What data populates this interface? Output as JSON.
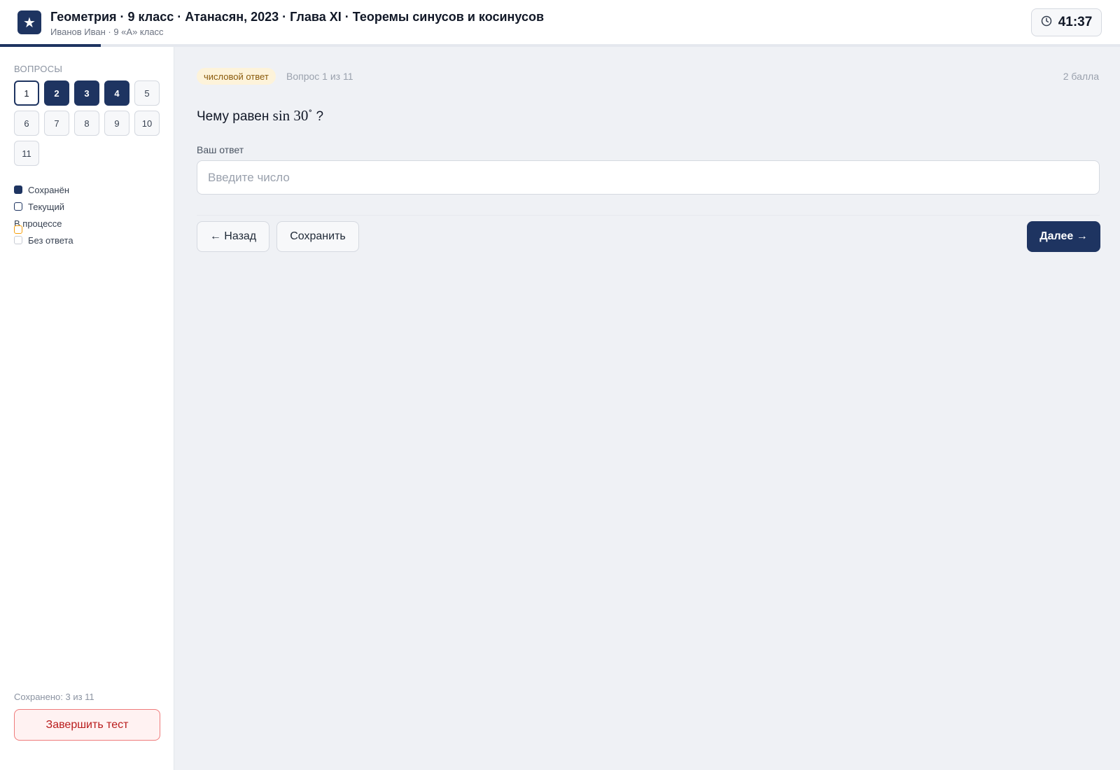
{
  "header": {
    "logo_glyph": "★",
    "title": "Геометрия · 9 класс · Атанасян, 2023 · Глава XI · Теоремы синусов и косинусов",
    "subtitle": "Иванов Иван · 9 «А» класс",
    "timer": "41:37",
    "timer_icon": "clock-icon"
  },
  "progress": {
    "fraction": 0.09
  },
  "sidebar": {
    "heading": "ВОПРОСЫ",
    "questions": [
      {
        "label": "1",
        "state": "current"
      },
      {
        "label": "2",
        "state": "saved"
      },
      {
        "label": "3",
        "state": "saved"
      },
      {
        "label": "4",
        "state": "saved"
      },
      {
        "label": "5",
        "state": "empty"
      },
      {
        "label": "6",
        "state": "empty"
      },
      {
        "label": "7",
        "state": "empty"
      },
      {
        "label": "8",
        "state": "empty"
      },
      {
        "label": "9",
        "state": "empty"
      },
      {
        "label": "10",
        "state": "empty"
      },
      {
        "label": "11",
        "state": "empty"
      }
    ],
    "legend": [
      {
        "label": "Сохранён",
        "state": "saved"
      },
      {
        "label": "Текущий",
        "state": "current"
      },
      {
        "label": "В процессе",
        "state": "progress"
      },
      {
        "label": "Без ответа",
        "state": "empty"
      }
    ],
    "saved_count": "Сохранено: 3 из 11",
    "finish_label": "Завершить тест"
  },
  "question": {
    "type_tag": "числовой ответ",
    "number_text": "Вопрос 1 из 11",
    "points": "2 балла",
    "text_prefix": "Чему равен ",
    "math_func": "sin",
    "math_value": "30",
    "math_degree": "∘",
    "text_suffix": "?",
    "answer_label": "Ваш ответ",
    "answer_placeholder": "Введите число",
    "answer_value": ""
  },
  "nav": {
    "back_label": "← Назад",
    "save_label": "Сохранить",
    "next_label": "Далее →"
  },
  "colors": {
    "accent": "#1e3461",
    "danger": "#b91c1c",
    "in_progress": "#f59e0b"
  }
}
